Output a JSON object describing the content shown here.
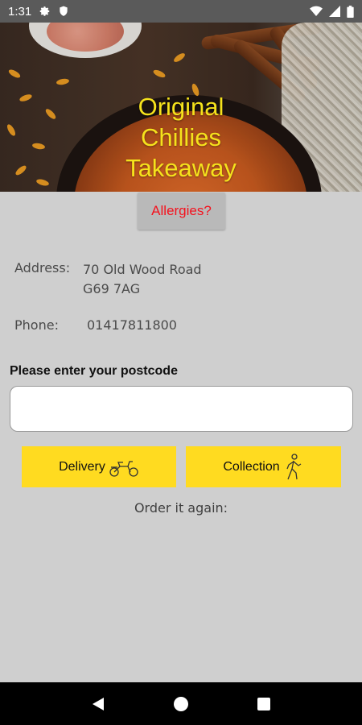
{
  "status_bar": {
    "time": "1:31",
    "left_icons": [
      "gear-icon",
      "shield-icon"
    ],
    "right_icons": [
      "wifi-icon",
      "signal-icon",
      "battery-icon"
    ]
  },
  "header": {
    "title_lines": [
      "Original",
      "Chillies",
      "Takeaway"
    ],
    "title_color": "#f5e21c"
  },
  "allergies": {
    "label": "Allergies?",
    "color": "#f4111d"
  },
  "info": {
    "address_label": "Address:",
    "address_line1": "70 Old Wood Road",
    "address_line2": "G69 7AG",
    "phone_label": "Phone:",
    "phone_value": "01417811800"
  },
  "postcode": {
    "label": "Please enter your postcode",
    "value": "",
    "placeholder": ""
  },
  "actions": {
    "delivery_label": "Delivery",
    "delivery_icon": "scooter-icon",
    "collection_label": "Collection",
    "collection_icon": "walking-person-icon",
    "accent": "#ffdb20"
  },
  "order_again_label": "Order it again:",
  "nav_bar": {
    "icons": [
      "back-icon",
      "home-icon",
      "recents-icon"
    ]
  }
}
